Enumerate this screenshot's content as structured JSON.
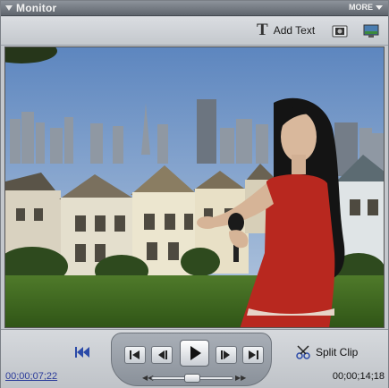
{
  "panel": {
    "title": "Monitor",
    "more_label": "MORE"
  },
  "toolbar": {
    "add_text_label": "Add Text",
    "add_text_icon": "T",
    "snapshot_icon": "camera-icon",
    "display_icon": "monitor-icon"
  },
  "video": {
    "description_icon": "video-frame"
  },
  "transport": {
    "current_timecode": "00;00;07;22",
    "duration_timecode": "00;00;14;18",
    "split_clip_label": "Split Clip",
    "go_to_start_icon": "go-to-start-icon",
    "prev_edit_icon": "previous-edit-icon",
    "step_back_icon": "step-back-icon",
    "play_icon": "play-icon",
    "step_forward_icon": "step-forward-icon",
    "next_edit_icon": "next-edit-icon",
    "shuttle_position": 0.5
  },
  "colors": {
    "accent": "#2a3a9a",
    "titlebar": "#6f757d",
    "panel": "#c3c7cc"
  }
}
